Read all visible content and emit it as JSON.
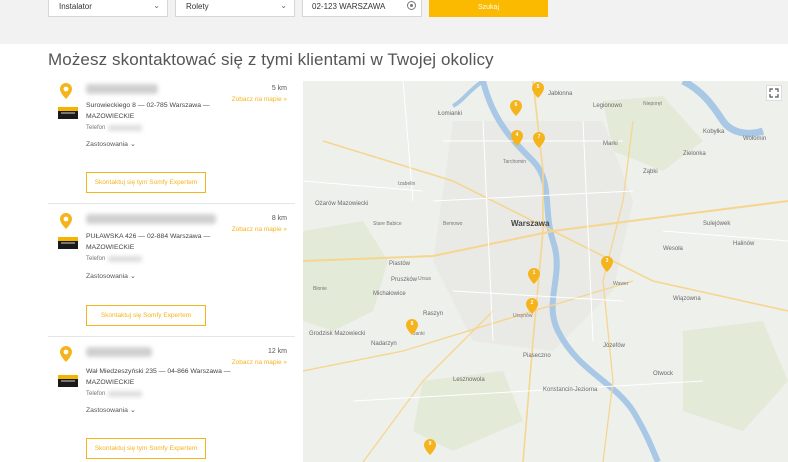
{
  "search": {
    "category": "Instalator",
    "product": "Rolety",
    "location": "02-123 WARSZAWA",
    "button_label": "Szukaj"
  },
  "heading": "Możesz skontaktować się z tymi klientami w Twojej okolicy",
  "colors": {
    "accent": "#f5b41c",
    "button": "#fbb900"
  },
  "results": [
    {
      "distance": "5 km",
      "map_link": "Zobacz na mapie »",
      "address": "Surowieckiego 8 — 02-785 Warszawa — MAZOWIECKIE",
      "phone_label": "Telefon",
      "applications": "Zastosowania",
      "contact_label": "Skontaktuj się tym Somfy Expertem"
    },
    {
      "distance": "8 km",
      "map_link": "Zobacz na mapie »",
      "address": "PUŁAWSKA 426 — 02-884 Warszawa — MAZOWIECKIE",
      "phone_label": "Telefon",
      "applications": "Zastosowania",
      "contact_label": "Skontaktuj się Somfy Expertem"
    },
    {
      "distance": "12 km",
      "map_link": "Zobacz na mapie »",
      "address": "Wał Miedzeszyński 235 — 04-866 Warszawa — MAZOWIECKIE",
      "phone_label": "Telefon",
      "applications": "Zastosowania",
      "contact_label": "Skontaktuj się tym Somfy Expertem"
    }
  ],
  "map": {
    "city": "Warszawa",
    "labels": [
      "Łomianki",
      "Jabłonna",
      "Legionowo",
      "Marki",
      "Ząbki",
      "Zielonka",
      "Kobyłka",
      "Wołomin",
      "Ożarów Mazowiecki",
      "Pruszków",
      "Piastów",
      "Raszyn",
      "Piaseczno",
      "Józefów",
      "Otwock",
      "Wiązowna",
      "Sulejówek",
      "Halinów",
      "Grodzisk Mazowiecki",
      "Nadarzyn",
      "Lesznowola",
      "Konstancin-Jeziorna",
      "Wesoła",
      "Michałowice",
      "Janki",
      "Błonie",
      "Stare Babice",
      "Izabelin",
      "Nieporęt",
      "Tarchomin",
      "Bemowo",
      "Wawer",
      "Ursus",
      "Ursynów"
    ],
    "markers": [
      "1",
      "2",
      "3",
      "4",
      "5",
      "6",
      "7",
      "8",
      "9"
    ],
    "fullscreen_icon": "expand-icon"
  }
}
